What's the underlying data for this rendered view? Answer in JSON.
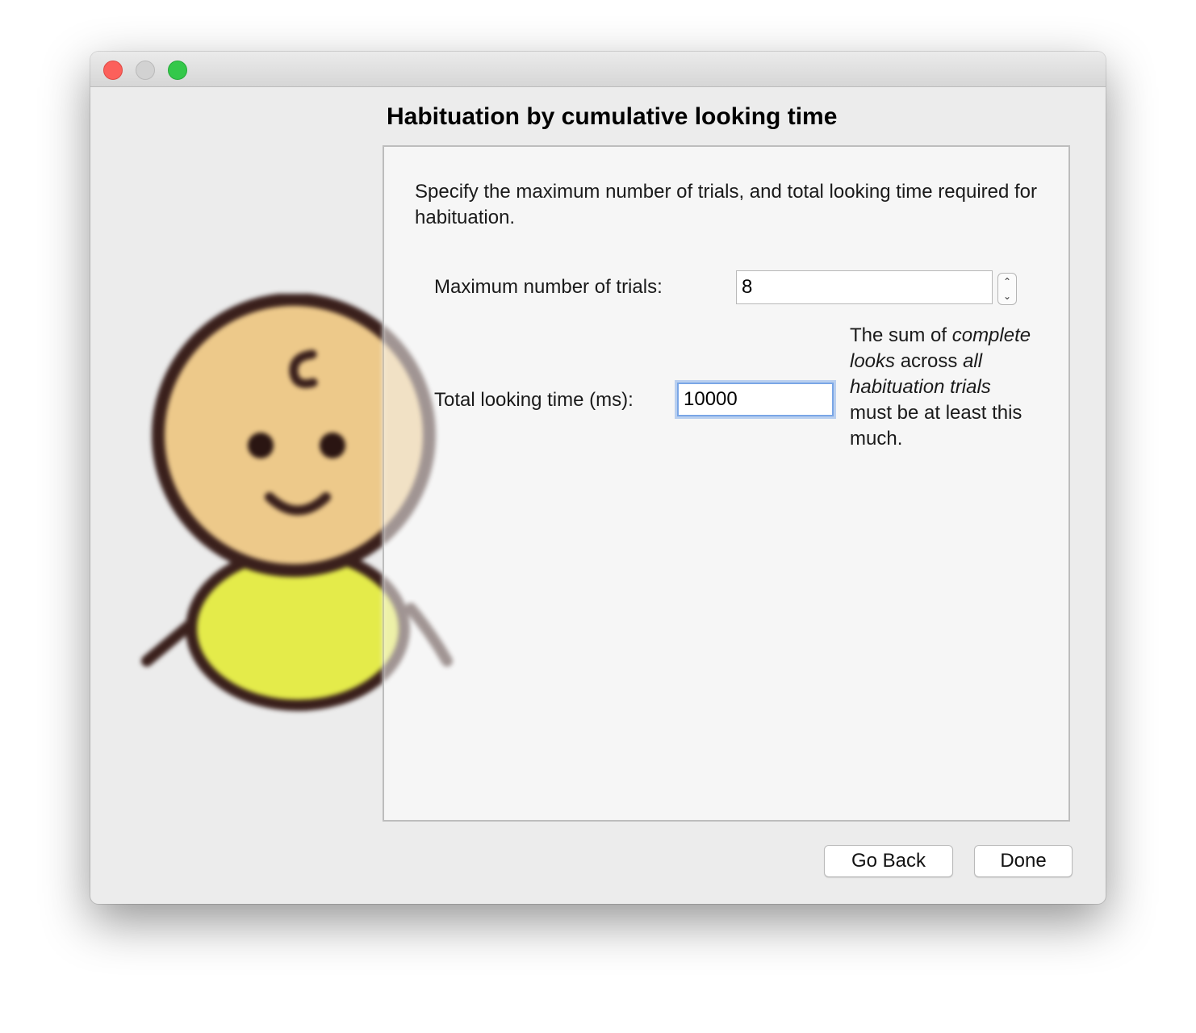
{
  "window": {
    "controls": [
      {
        "name": "close",
        "color": "#fc605b"
      },
      {
        "name": "minimize",
        "color": "#d2d2d2"
      },
      {
        "name": "zoom",
        "color": "#34c84a"
      }
    ]
  },
  "sidebar_illustration": {
    "subject": "baby-icon",
    "colors": {
      "face": "#edc98a",
      "bib": "#e4eb4a",
      "outline": "#3a201c"
    }
  },
  "page": {
    "title": "Habituation by cumulative looking time",
    "description": "Specify the maximum number of trials, and total looking time required for habituation.",
    "max_trials": {
      "label": "Maximum number of trials:",
      "value": "8"
    },
    "total_looking_time": {
      "label": "Total looking time (ms):",
      "value": "10000",
      "hint": {
        "part1": "The sum of",
        "part2_italic": "complete looks",
        "part3": "across",
        "part4_italic": "all habituation trials",
        "part5": "must be at least this much."
      }
    }
  },
  "buttons": {
    "go_back": "Go Back",
    "done": "Done"
  },
  "colors": {
    "window_bg": "#ececec",
    "panel_bg": "#f6f6f6",
    "focus_ring": "#7aa6e6"
  }
}
